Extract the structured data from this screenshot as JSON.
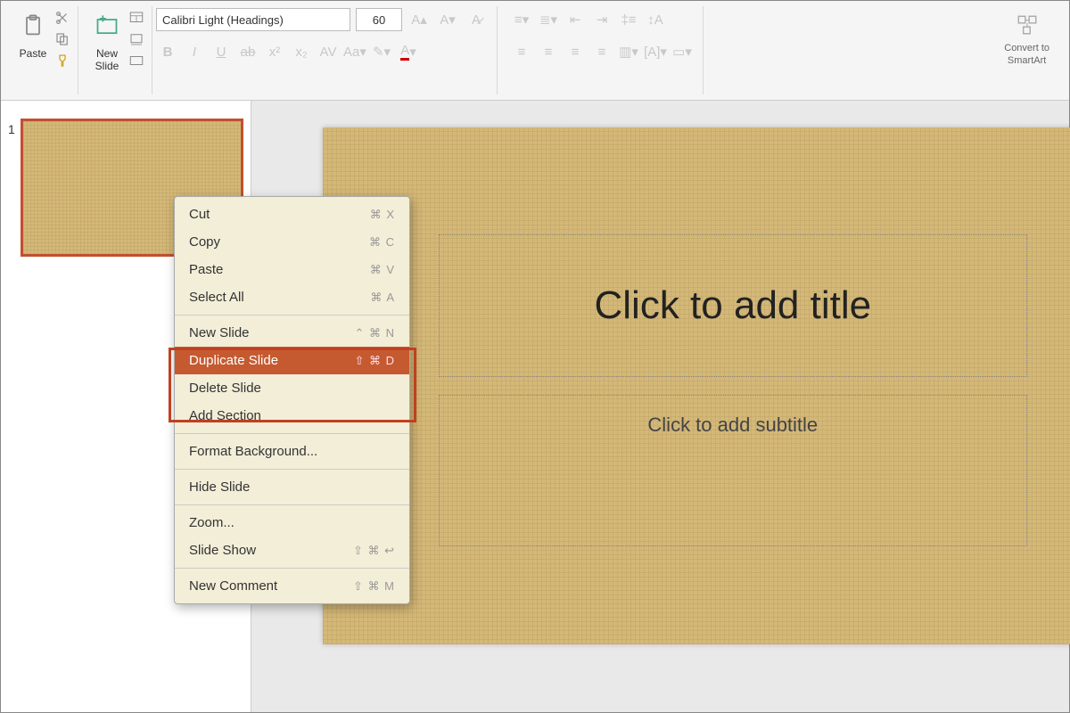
{
  "ribbon": {
    "paste_label": "Paste",
    "new_slide_label": "New\nSlide",
    "font_name": "Calibri Light (Headings)",
    "font_size": "60",
    "convert_label": "Convert to\nSmartArt"
  },
  "thumb": {
    "number": "1"
  },
  "slide": {
    "title_placeholder": "Click to add title",
    "subtitle_placeholder": "Click to add subtitle"
  },
  "context_menu": {
    "items": [
      {
        "label": "Cut",
        "shortcut": "⌘ X"
      },
      {
        "label": "Copy",
        "shortcut": "⌘ C"
      },
      {
        "label": "Paste",
        "shortcut": "⌘ V"
      },
      {
        "label": "Select All",
        "shortcut": "⌘ A"
      },
      {
        "label": "New Slide",
        "shortcut": "⌃ ⌘ N"
      },
      {
        "label": "Duplicate Slide",
        "shortcut": "⇧ ⌘ D"
      },
      {
        "label": "Delete Slide",
        "shortcut": ""
      },
      {
        "label": "Add Section",
        "shortcut": ""
      },
      {
        "label": "Format Background...",
        "shortcut": ""
      },
      {
        "label": "Hide Slide",
        "shortcut": ""
      },
      {
        "label": "Zoom...",
        "shortcut": ""
      },
      {
        "label": "Slide Show",
        "shortcut": "⇧ ⌘ ↩"
      },
      {
        "label": "New Comment",
        "shortcut": "⇧ ⌘ M"
      }
    ]
  }
}
